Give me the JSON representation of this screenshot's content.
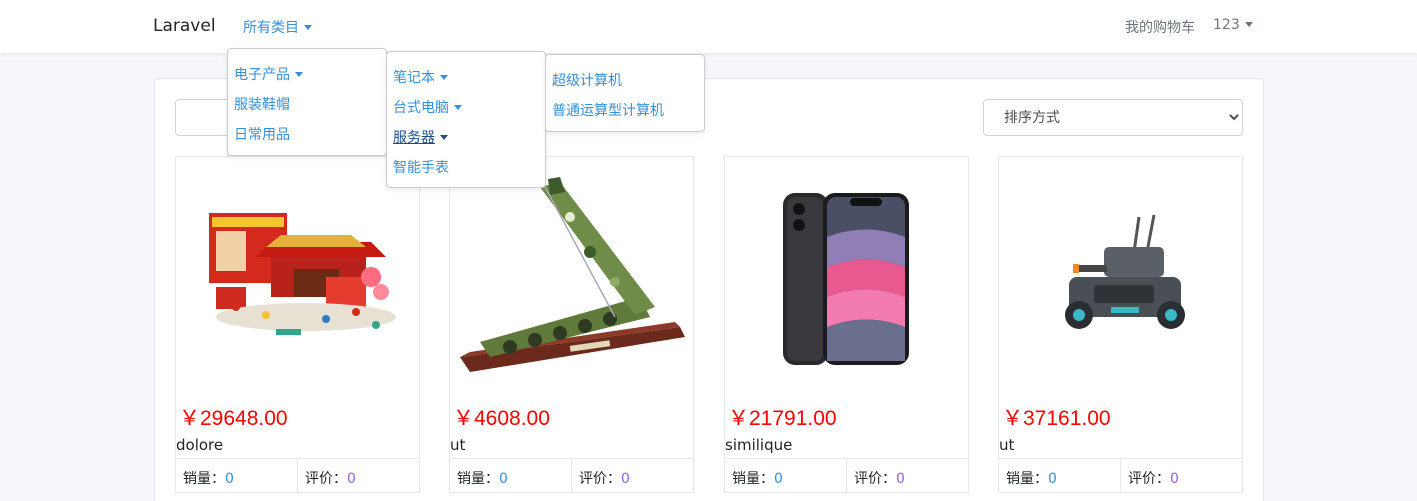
{
  "navbar": {
    "brand": "Laravel",
    "categories_label": "所有类目",
    "cart_label": "我的购物车",
    "user_label": "123"
  },
  "filters": {
    "search_value": "",
    "sort_selected": "排序方式"
  },
  "menus": {
    "level1": [
      "电子产品",
      "服装鞋帽",
      "日常用品"
    ],
    "level2": [
      "笔记本",
      "台式电脑",
      "服务器",
      "智能手表"
    ],
    "level3": [
      "超级计算机",
      "普通运算型计算机"
    ]
  },
  "labels": {
    "sold": "销量：",
    "reviews": "评价："
  },
  "products": [
    {
      "price": "￥29648.00",
      "name": "dolore",
      "sold": "0",
      "reviews": "0",
      "image": "lego-festival-set"
    },
    {
      "price": "￥4608.00",
      "name": "ut",
      "sold": "0",
      "reviews": "0",
      "image": "missile-launcher-model"
    },
    {
      "price": "￥21791.00",
      "name": "similique",
      "sold": "0",
      "reviews": "0",
      "image": "smartphone"
    },
    {
      "price": "￥37161.00",
      "name": "ut",
      "sold": "0",
      "reviews": "0",
      "image": "robot-vehicle"
    }
  ],
  "colors": {
    "link": "#3490dc",
    "price": "#ff0000",
    "review_count": "#9561e2",
    "muted": "#6c757d"
  }
}
